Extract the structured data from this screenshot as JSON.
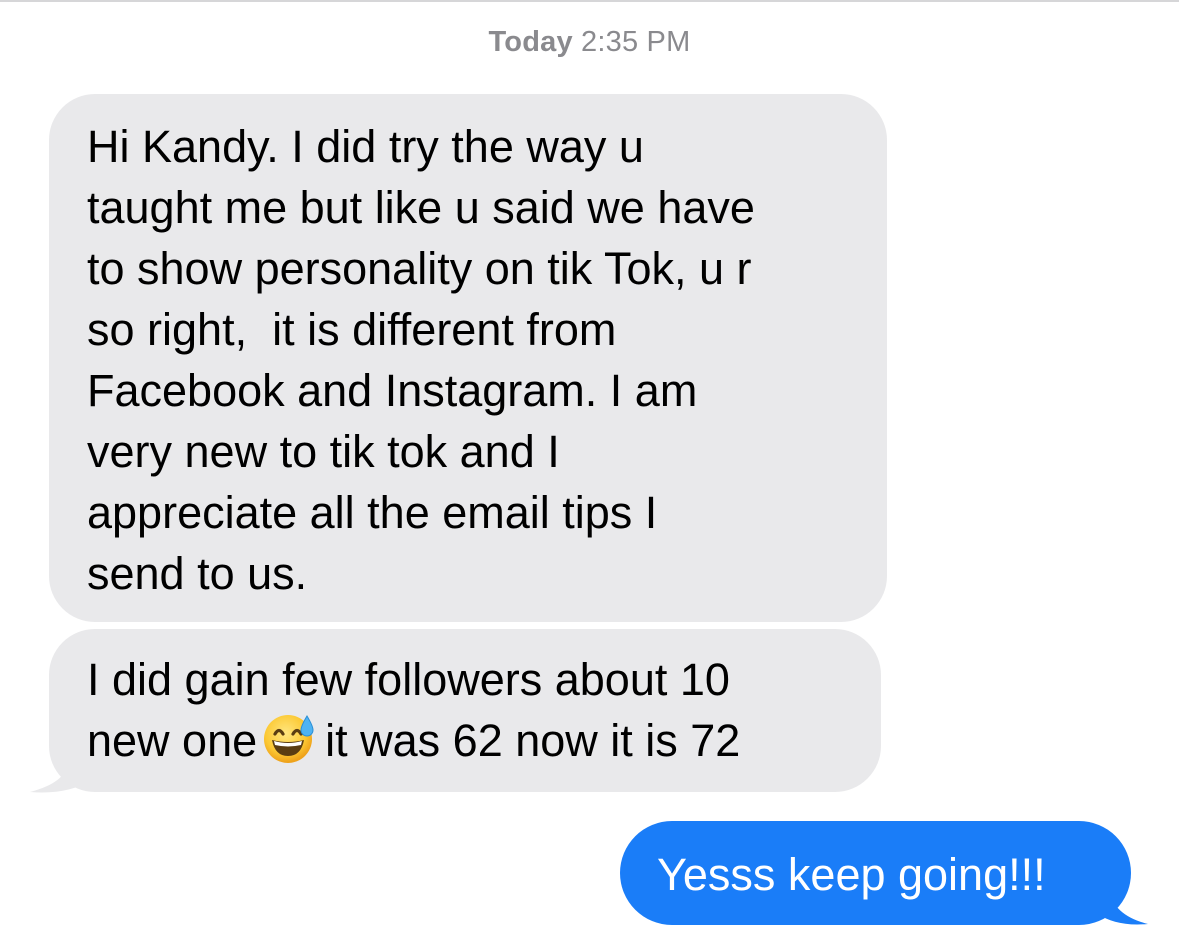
{
  "timestamp": {
    "day": "Today",
    "time": "2:35 PM"
  },
  "messages": [
    {
      "direction": "incoming",
      "lines": [
        "Hi Kandy. I did try the way u",
        "taught me but like u said we have",
        "to show personality on tik Tok, u r",
        "so right,  it is different from",
        "Facebook and Instagram. I am",
        "very new to tik tok and I",
        "appreciate all the email tips I",
        "send to us."
      ]
    },
    {
      "direction": "incoming",
      "line1": "I did gain few followers about 10",
      "line2_before": "new one",
      "emoji": "grinning-face-with-sweat-emoji",
      "line2_after": "it was 62 now it is 72"
    },
    {
      "direction": "outgoing",
      "text": "Yesss keep going!!!"
    }
  ],
  "colors": {
    "incoming_bubble": "#e9e9eb",
    "outgoing_bubble": "#1a7df8",
    "timestamp": "#8a8a8e",
    "text_dark": "#000000",
    "text_light": "#ffffff"
  }
}
